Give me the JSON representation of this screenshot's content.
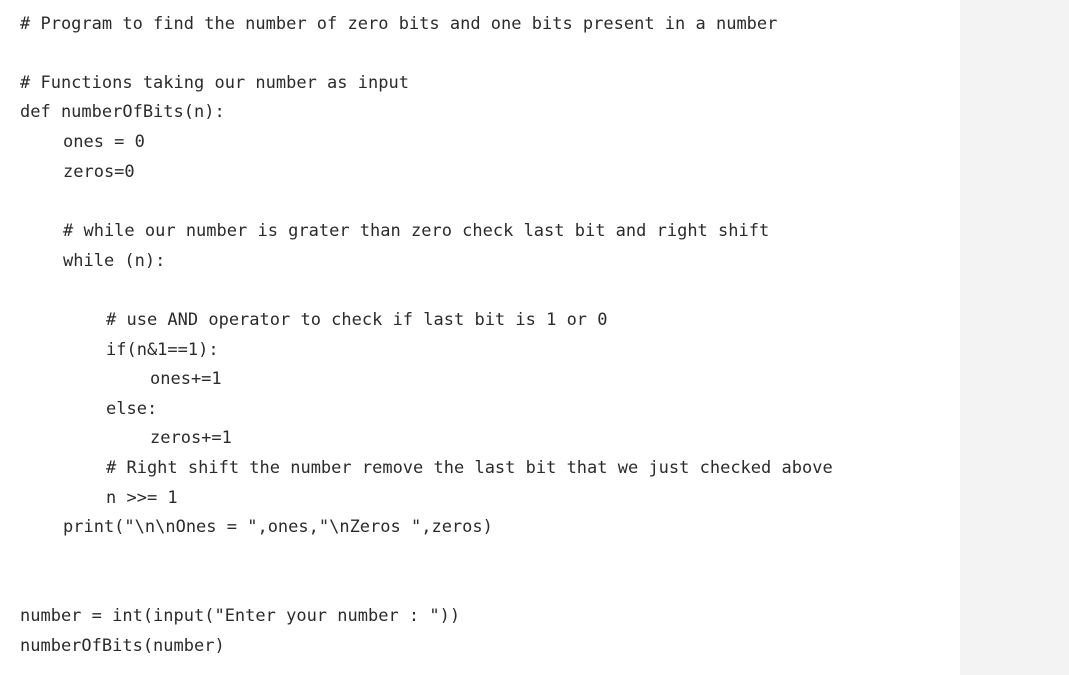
{
  "code": {
    "lines": [
      {
        "indent": 0,
        "text": "# Program to find the number of zero bits and one bits present in a number"
      },
      {
        "indent": 0,
        "text": ""
      },
      {
        "indent": 0,
        "text": "# Functions taking our number as input"
      },
      {
        "indent": 0,
        "text": "def numberOfBits(n):"
      },
      {
        "indent": 1,
        "text": "ones = 0"
      },
      {
        "indent": 1,
        "text": "zeros=0"
      },
      {
        "indent": 0,
        "text": ""
      },
      {
        "indent": 1,
        "text": "# while our number is grater than zero check last bit and right shift"
      },
      {
        "indent": 1,
        "text": "while (n):"
      },
      {
        "indent": 0,
        "text": ""
      },
      {
        "indent": 2,
        "text": "# use AND operator to check if last bit is 1 or 0"
      },
      {
        "indent": 2,
        "text": "if(n&1==1):"
      },
      {
        "indent": 3,
        "text": "ones+=1"
      },
      {
        "indent": 2,
        "text": "else:"
      },
      {
        "indent": 3,
        "text": "zeros+=1"
      },
      {
        "indent": 2,
        "text": "# Right shift the number remove the last bit that we just checked above"
      },
      {
        "indent": 2,
        "text": "n >>= 1"
      },
      {
        "indent": 1,
        "text": "print(\"\\n\\nOnes = \",ones,\"\\nZeros \",zeros)"
      },
      {
        "indent": 0,
        "text": ""
      },
      {
        "indent": 0,
        "text": ""
      },
      {
        "indent": 0,
        "text": "number = int(input(\"Enter your number : \"))"
      },
      {
        "indent": 0,
        "text": "numberOfBits(number)"
      }
    ]
  },
  "colors": {
    "background": "#ffffff",
    "side_panel": "#f3f3f3",
    "text": "#2b2b2b"
  }
}
